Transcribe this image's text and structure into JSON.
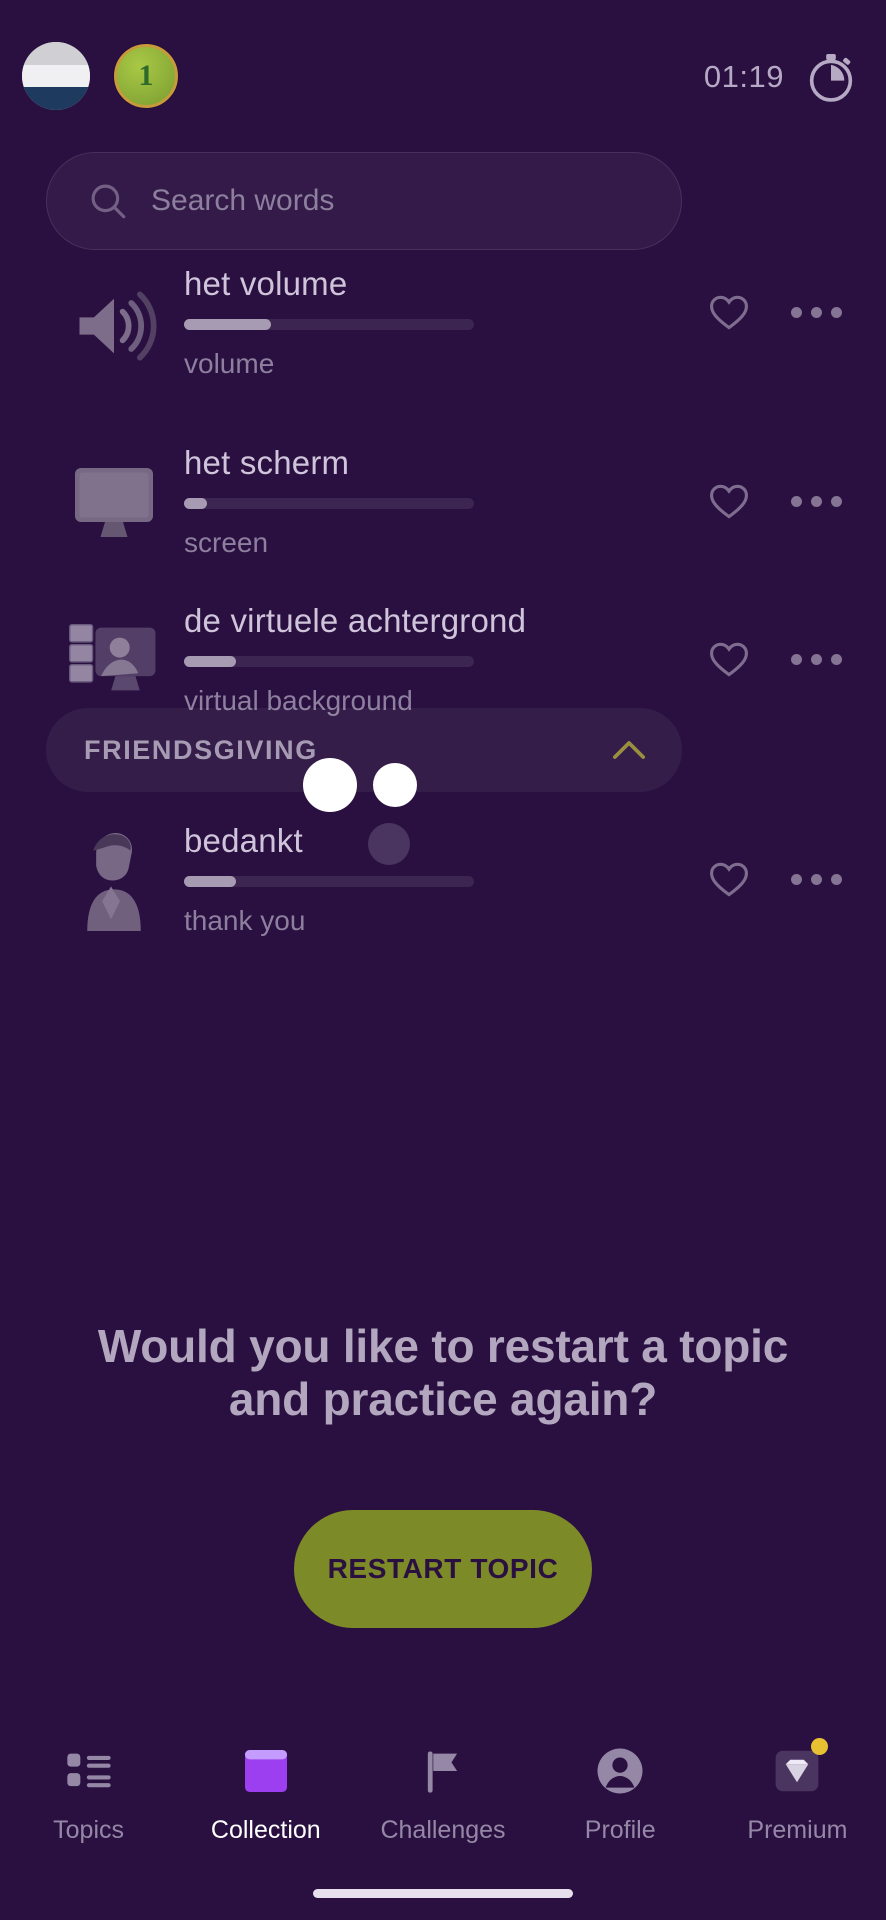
{
  "app": {
    "background_color": "#2a1040",
    "accent_color": "#7c8a28"
  },
  "topbar": {
    "language_flag": "dutch-flag",
    "level_badge": "1",
    "timer": "01:19",
    "timer_icon": "stopwatch-icon"
  },
  "search": {
    "placeholder": "Search words",
    "value": "",
    "icon": "search-icon"
  },
  "word_list": [
    {
      "icon": "speaker-volume-icon",
      "title": "het volume",
      "translation": "volume",
      "progress": 30,
      "favorite_icon": "heart-outline-icon",
      "more_icon": "more-horizontal-icon",
      "clipped": true
    },
    {
      "icon": "monitor-screen-icon",
      "title": "het scherm",
      "translation": "screen",
      "progress": 8,
      "favorite_icon": "heart-outline-icon",
      "more_icon": "more-horizontal-icon",
      "clipped": false
    },
    {
      "icon": "virtual-background-icon",
      "title": "de virtuele achtergrond",
      "translation": "virtual background",
      "progress": 18,
      "favorite_icon": "heart-outline-icon",
      "more_icon": "more-horizontal-icon",
      "clipped": false
    }
  ],
  "section": {
    "title": "FRIENDSGIVING",
    "chevron_icon": "chevron-up-icon",
    "expanded": true
  },
  "section_words": [
    {
      "icon": "praying-person-icon",
      "title": "bedankt",
      "translation": "thank you",
      "progress": 18,
      "favorite_icon": "heart-outline-icon",
      "more_icon": "more-horizontal-icon"
    }
  ],
  "loading": {
    "visible": true,
    "dot_count": 2
  },
  "restart": {
    "question": "Would you like to restart a topic and practice again?",
    "button_label": "RESTART TOPIC",
    "button_color": "#7c8a28"
  },
  "bottom_nav": {
    "items": [
      {
        "label": "Topics",
        "icon": "list-icon",
        "active": false,
        "badge": false
      },
      {
        "label": "Collection",
        "icon": "book-icon",
        "active": true,
        "badge": false
      },
      {
        "label": "Challenges",
        "icon": "flag-icon",
        "active": false,
        "badge": false
      },
      {
        "label": "Profile",
        "icon": "person-icon",
        "active": false,
        "badge": false
      },
      {
        "label": "Premium",
        "icon": "diamond-icon",
        "active": false,
        "badge": true
      }
    ]
  }
}
